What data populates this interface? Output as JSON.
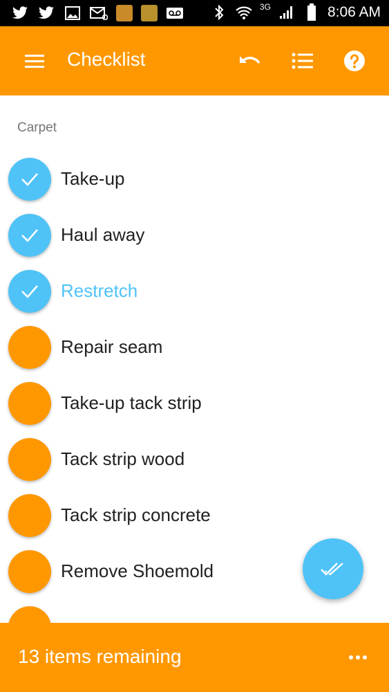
{
  "status_bar": {
    "time": "8:06 AM",
    "network": "3G",
    "left_icons": [
      "twitter-icon",
      "twitter-icon",
      "image-icon",
      "email-icon",
      "app-icon",
      "app-icon",
      "voicemail-icon"
    ],
    "right_icons": [
      "bluetooth-icon",
      "wifi-icon",
      "signal-icon",
      "battery-icon"
    ]
  },
  "app_bar": {
    "title": "Checklist",
    "color": "#FF9800",
    "actions": [
      "undo-icon",
      "list-icon",
      "help-icon"
    ]
  },
  "section": {
    "label": "Carpet"
  },
  "items": [
    {
      "label": "Take-up",
      "checked": true
    },
    {
      "label": "Haul away",
      "checked": true
    },
    {
      "label": "Restretch",
      "checked": true,
      "active": true
    },
    {
      "label": "Repair seam",
      "checked": false
    },
    {
      "label": "Take-up tack strip",
      "checked": false
    },
    {
      "label": "Tack strip wood",
      "checked": false
    },
    {
      "label": "Tack strip concrete",
      "checked": false
    },
    {
      "label": "Remove Shoemold",
      "checked": false
    },
    {
      "label": "",
      "checked": false
    }
  ],
  "bottom_bar": {
    "remaining_text": "13 items remaining"
  },
  "colors": {
    "accent": "#FF9800",
    "checked": "#4FC3F7",
    "text": "#212121",
    "section": "#757575"
  }
}
